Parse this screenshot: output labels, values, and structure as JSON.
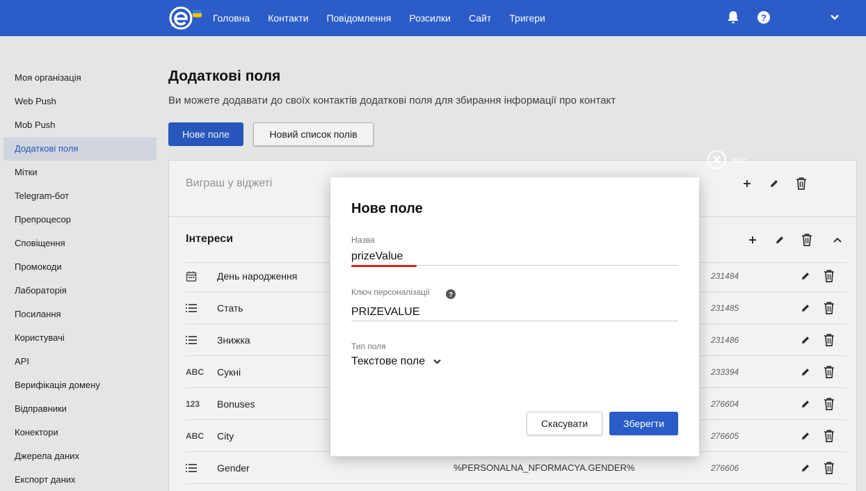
{
  "nav": {
    "items": [
      "Головна",
      "Контакти",
      "Повідомлення",
      "Розсилки",
      "Сайт",
      "Тригери"
    ]
  },
  "icons": {
    "logo": "esputnik-logo",
    "bell": "bell-icon",
    "help": "help-icon",
    "menu": "chevron-down-icon"
  },
  "sidebar": {
    "items": [
      {
        "label": "Моя організація"
      },
      {
        "label": "Web Push"
      },
      {
        "label": "Mob Push"
      },
      {
        "label": "Додаткові поля",
        "active": true
      },
      {
        "label": "Мітки"
      },
      {
        "label": "Telegram-бот"
      },
      {
        "label": "Препроцесор"
      },
      {
        "label": "Сповіщення"
      },
      {
        "label": "Промокоди"
      },
      {
        "label": "Лабораторія"
      },
      {
        "label": "Посилання"
      },
      {
        "label": "Користувачі"
      },
      {
        "label": "API"
      },
      {
        "label": "Верифікація домену"
      },
      {
        "label": "Відправники"
      },
      {
        "label": "Конектори"
      },
      {
        "label": "Джерела даних"
      },
      {
        "label": "Експорт даних"
      }
    ]
  },
  "page": {
    "title": "Додаткові поля",
    "subtitle": "Ви можете додавати до своїх контактів додаткові поля для збирання інформації про контакт",
    "new_field_button": "Нове поле",
    "new_list_button": "Новий список полів"
  },
  "groups": {
    "first": {
      "title": "Виграш у віджеті"
    },
    "second": {
      "title": "Інтереси"
    }
  },
  "fields": [
    {
      "type_icon": "calendar-icon",
      "type_text": "",
      "name": "День народження",
      "key": "",
      "id": "231484"
    },
    {
      "type_icon": "list-icon",
      "type_text": "",
      "name": "Стать",
      "key": "",
      "id": "231485"
    },
    {
      "type_icon": "list-icon",
      "type_text": "",
      "name": "Знижка",
      "key": "",
      "id": "231486"
    },
    {
      "type_icon": "",
      "type_text": "ABC",
      "name": "Сукні",
      "key": "",
      "id": "233394"
    },
    {
      "type_icon": "",
      "type_text": "123",
      "name": "Bonuses",
      "key": "",
      "id": "276604"
    },
    {
      "type_icon": "",
      "type_text": "ABC",
      "name": "City",
      "key": "",
      "id": "276605"
    },
    {
      "type_icon": "list-icon",
      "type_text": "",
      "name": "Gender",
      "key": "%PERSONALNA_NFORMACYA.GENDER%",
      "id": "276606"
    }
  ],
  "modal": {
    "esc_label": "esc",
    "title": "Нове поле",
    "name_label": "Назва",
    "name_value": "prizeValue",
    "key_label": "Ключ персоналізації",
    "key_value": "PRIZEVALUE",
    "type_label": "Тип поля",
    "type_value": "Текстове поле",
    "cancel_label": "Скасувати",
    "save_label": "Зберегти"
  },
  "colors": {
    "primary": "#2b5cc7",
    "accent_underline": "#e02020",
    "logo_flag_blue": "#2f7bd8",
    "logo_flag_yellow": "#f5c400"
  }
}
